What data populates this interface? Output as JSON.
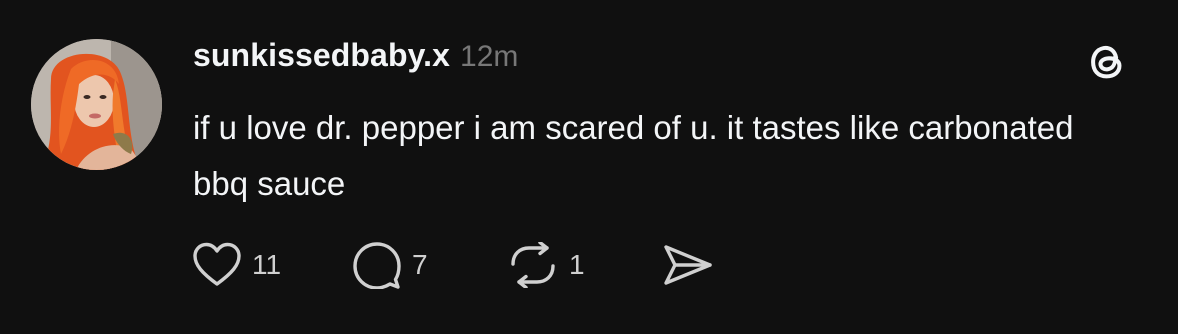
{
  "post": {
    "username": "sunkissedbaby.x",
    "timestamp": "12m",
    "text": "if u love dr. pepper i am scared of u. it tastes like carbonated bbq sauce",
    "avatar_icon": "profile-photo",
    "app_icon": "threads-logo-icon"
  },
  "actions": {
    "like_count": "11",
    "reply_count": "7",
    "repost_count": "1",
    "like_icon": "heart-icon",
    "reply_icon": "comment-bubble-icon",
    "repost_icon": "repost-icon",
    "share_icon": "send-icon"
  },
  "colors": {
    "background": "#101010",
    "text": "#f3f5f7",
    "muted": "#777777",
    "icon": "#d0d0d0"
  }
}
